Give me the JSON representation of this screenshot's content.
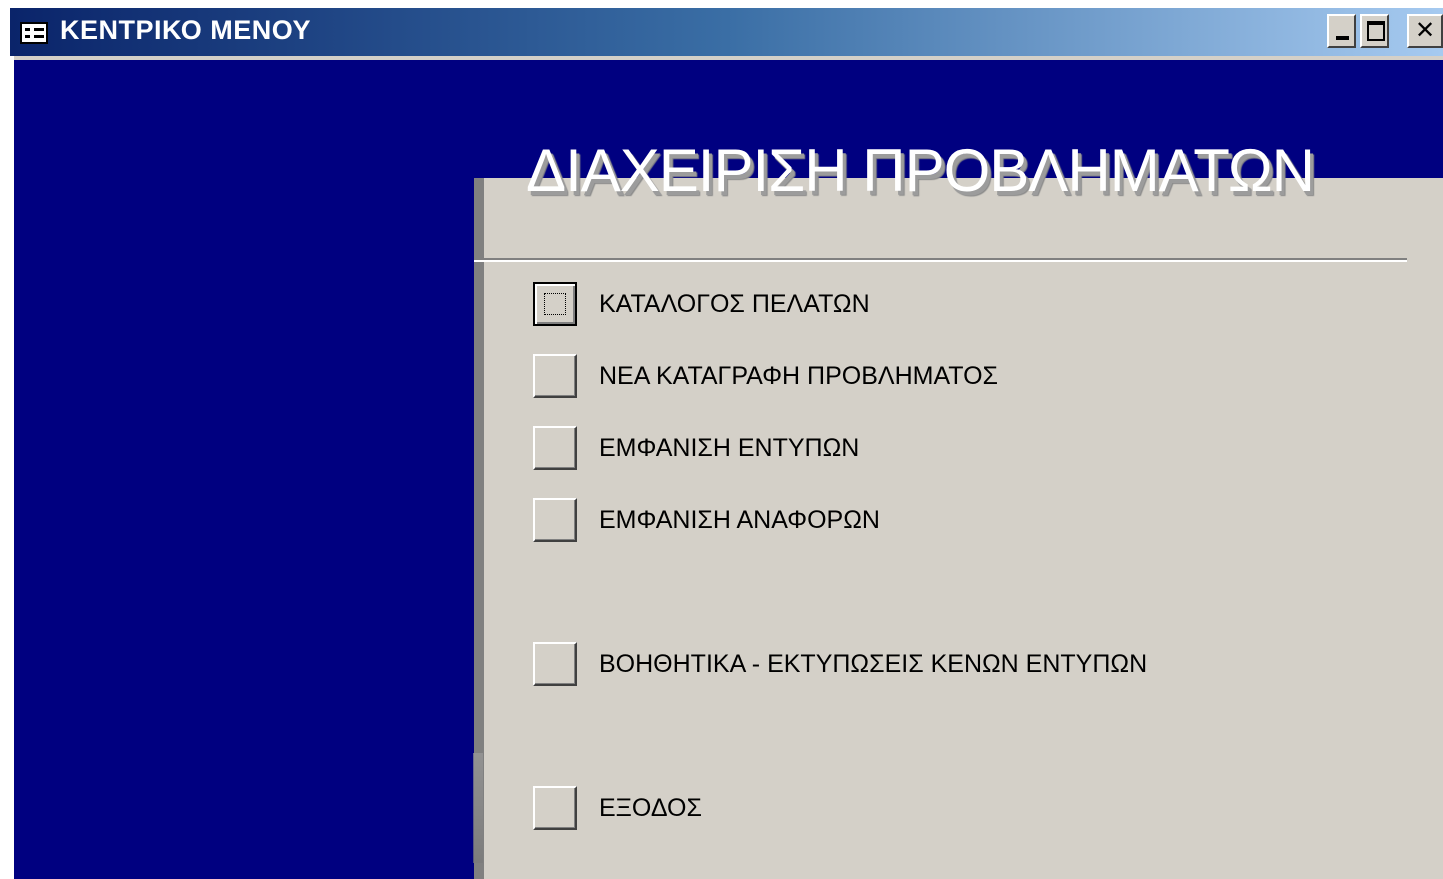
{
  "window": {
    "title": "ΚΕΝΤΡΙΚΟ ΜΕΝΟΥ",
    "app_icon": "form-icon",
    "controls": {
      "minimize_icon": "minimize-icon",
      "maximize_icon": "maximize-icon",
      "close_icon": "close-icon"
    }
  },
  "colors": {
    "background_blue": "#000080",
    "panel_gray": "#d4d0c8",
    "heading_text": "#ffffff"
  },
  "heading": "ΔΙΑΧΕΙΡΙΣΗ ΠΡΟΒΛΗΜΑΤΩΝ",
  "menu": {
    "items": [
      {
        "label": "ΚΑΤΑΛΟΓΟΣ ΠΕΛΑΤΩΝ",
        "focused": true
      },
      {
        "label": "ΝΕΑ ΚΑΤΑΓΡΑΦΗ ΠΡΟΒΛΗΜΑΤΟΣ",
        "focused": false
      },
      {
        "label": "ΕΜΦΑΝΙΣΗ ΕΝΤΥΠΩΝ",
        "focused": false
      },
      {
        "label": "ΕΜΦΑΝΙΣΗ ΑΝΑΦΟΡΩΝ",
        "focused": false
      },
      {
        "label": "ΒΟΗΘΗΤΙΚΑ - ΕΚΤΥΠΩΣΕΙΣ ΚΕΝΩΝ ΕΝΤΥΠΩΝ",
        "focused": false
      },
      {
        "label": "ΕΞΟΔΟΣ",
        "focused": false
      }
    ]
  }
}
